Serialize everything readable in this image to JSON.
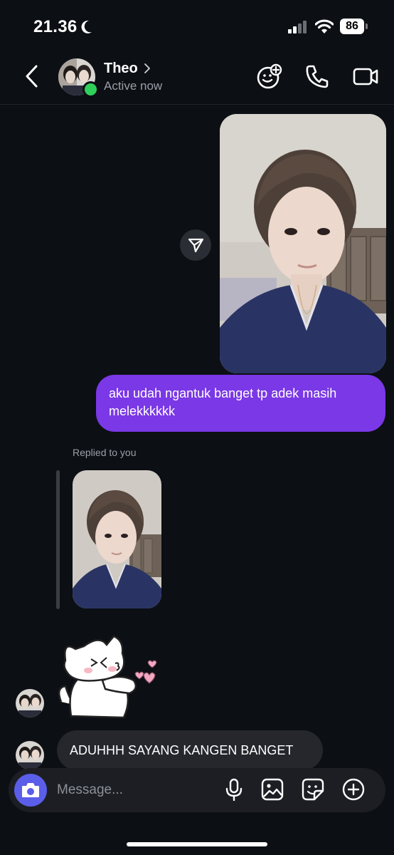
{
  "status_bar": {
    "time": "21.36",
    "battery": "86"
  },
  "header": {
    "name": "Theo",
    "status": "Active now"
  },
  "messages": {
    "outgoing_text": "aku udah ngantuk banget tp adek masih melekkkkkk",
    "replied_label": "Replied to you",
    "incoming_text": "ADUHHH SAYANG KANGEN BANGET"
  },
  "composer": {
    "placeholder": "Message..."
  },
  "icons": {
    "status": [
      "moon-icon",
      "signal-icon",
      "wifi-icon",
      "battery-icon"
    ],
    "header": [
      "back-icon",
      "chevron-right-icon",
      "effects-icon",
      "phone-icon",
      "video-icon"
    ],
    "chat": [
      "share-icon"
    ],
    "composer": [
      "camera-icon",
      "mic-icon",
      "gallery-icon",
      "sticker-icon",
      "add-icon"
    ]
  },
  "colors": {
    "background": "#0c0f14",
    "outgoing_bubble": "#7a38e6",
    "incoming_bubble": "#25272d",
    "camera_button": "#5b5ee8",
    "online": "#2fd05a"
  }
}
